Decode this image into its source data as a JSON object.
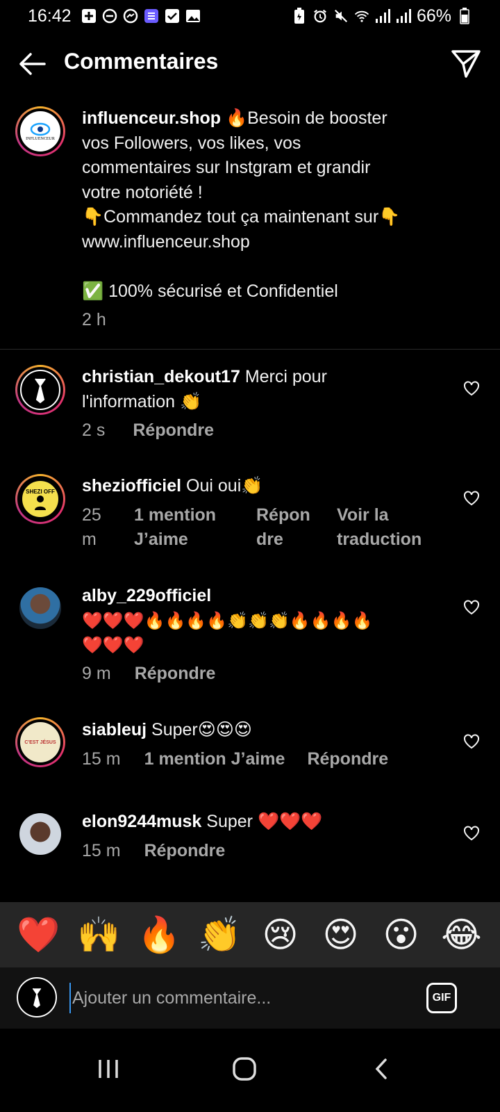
{
  "status_bar": {
    "time": "16:42",
    "battery": "66%"
  },
  "header": {
    "title": "Commentaires"
  },
  "caption": {
    "username": "influenceur.shop",
    "text_lines": [
      "🔥Besoin de booster",
      "vos Followers, vos likes, vos",
      "commentaires sur Instgram et grandir",
      "votre notoriété !",
      "👇Commandez tout ça maintenant sur👇",
      " www.influenceur.shop",
      "",
      "✅ 100% sécurisé et Confidentiel"
    ],
    "time": "2 h",
    "avatar_label": "INFLUENCEUR"
  },
  "comments": [
    {
      "username": "christian_dekout17",
      "text": "Merci pour",
      "text_line2": "l'information 👏",
      "time": "2 s",
      "reply": "Répondre"
    },
    {
      "username": "shezіofficiel",
      "text": "Oui oui👏",
      "time_line1": "25",
      "time_line2": "m",
      "likes_line1": "1 mention",
      "likes_line2": "J’aime",
      "reply_line1": "Répon",
      "reply_line2": "dre",
      "translate_line1": "Voir la",
      "translate_line2": "traduction",
      "avatar_label": "SHEZI OFF"
    },
    {
      "username": "alby_229officiel",
      "text_line1": "❤️❤️❤️🔥🔥🔥🔥👏👏👏🔥🔥🔥🔥",
      "text_line2": "❤️❤️❤️",
      "time": "9 m",
      "reply": "Répondre"
    },
    {
      "username": "siableuj",
      "text": "Super😍😍😍",
      "time": "15 m",
      "likes": "1 mention J’aime",
      "reply": "Répondre",
      "avatar_label": "C'EST JÉSUS"
    },
    {
      "username": "elon9244musk",
      "text": "Super ❤️❤️❤️",
      "time": "15 m",
      "reply": "Répondre"
    }
  ],
  "emoji_bar": [
    "❤️",
    "🙌",
    "🔥",
    "👏",
    "😢",
    "😍",
    "😮",
    "😂"
  ],
  "composer": {
    "placeholder": "Ajouter un commentaire...",
    "gif_label": "GIF"
  },
  "colors": {
    "background": "#000000",
    "secondary_text": "#a8a8a8",
    "emoji_bar_bg": "#262626",
    "story_ring": "#e1306c"
  }
}
